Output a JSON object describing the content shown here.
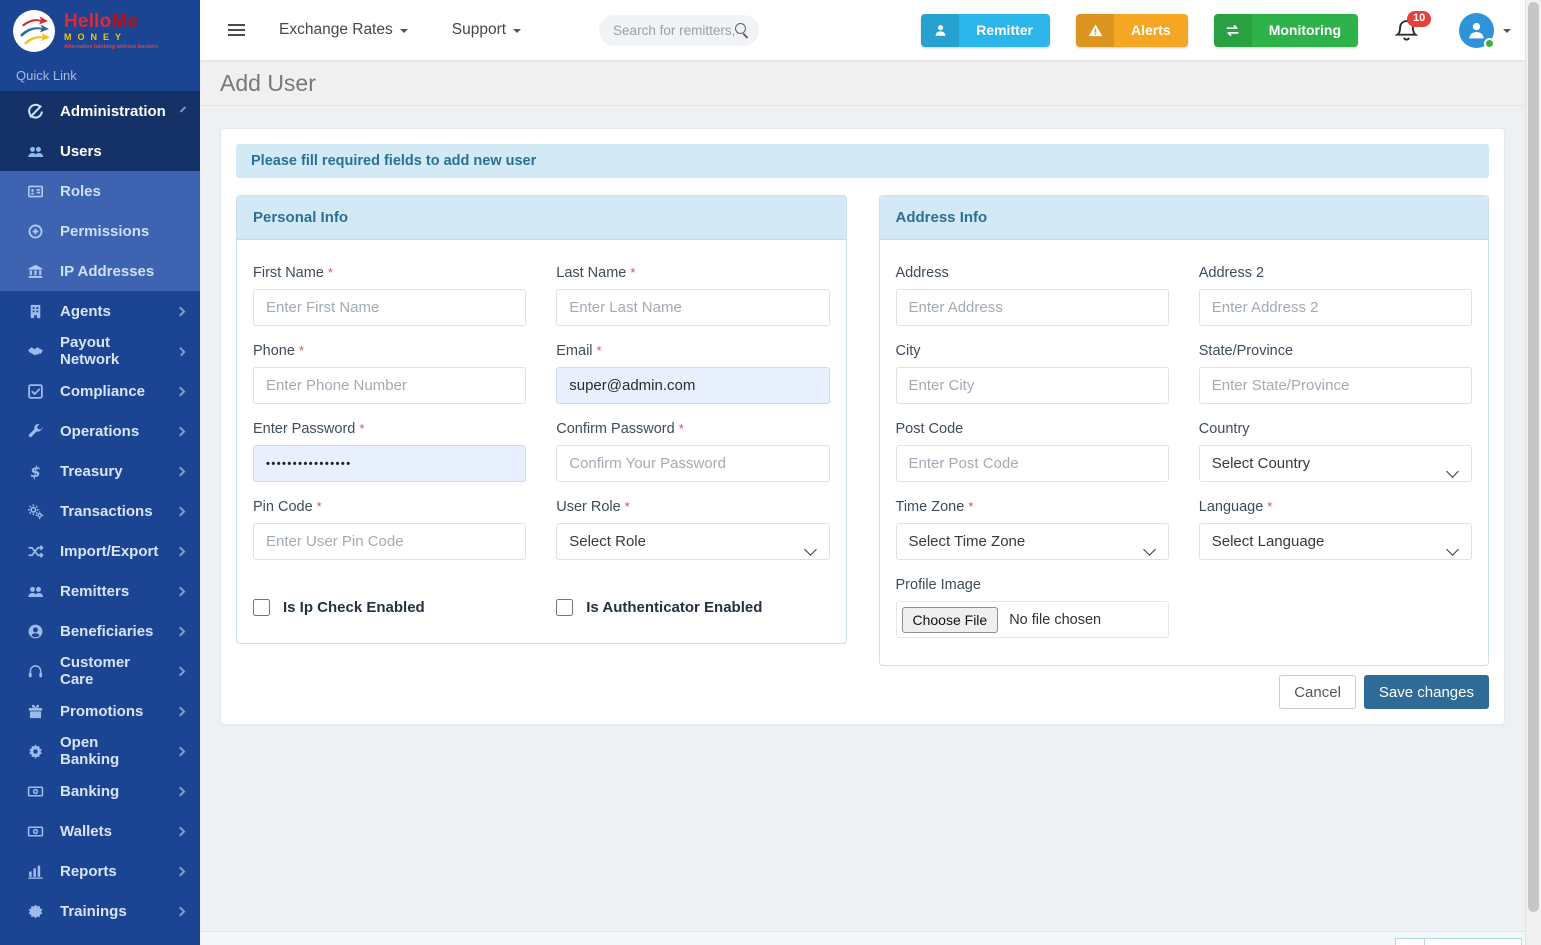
{
  "brand": {
    "hello": "Hello",
    "me": "Me",
    "money": "MONEY",
    "tagline": "Alternative banking without borders",
    "quick_link": "Quick Link"
  },
  "topbar": {
    "menus": [
      {
        "label": "Exchange Rates"
      },
      {
        "label": "Support"
      }
    ],
    "search_placeholder": "Search for remitters, do",
    "actions": [
      {
        "label": "Remitter"
      },
      {
        "label": "Alerts"
      },
      {
        "label": "Monitoring"
      }
    ],
    "notification_count": "10"
  },
  "sidebar": {
    "items": [
      {
        "label": "Administration"
      },
      {
        "label": "Users"
      },
      {
        "label": "Roles"
      },
      {
        "label": "Permissions"
      },
      {
        "label": "IP Addresses"
      },
      {
        "label": "Agents"
      },
      {
        "label": "Payout Network"
      },
      {
        "label": "Compliance"
      },
      {
        "label": "Operations"
      },
      {
        "label": "Treasury"
      },
      {
        "label": "Transactions"
      },
      {
        "label": "Import/Export"
      },
      {
        "label": "Remitters"
      },
      {
        "label": "Beneficiaries"
      },
      {
        "label": "Customer Care"
      },
      {
        "label": "Promotions"
      },
      {
        "label": "Open Banking"
      },
      {
        "label": "Banking"
      },
      {
        "label": "Wallets"
      },
      {
        "label": "Reports"
      },
      {
        "label": "Trainings"
      }
    ]
  },
  "page": {
    "title": "Add User",
    "alert": "Please fill required fields to add new user"
  },
  "personal": {
    "title": "Personal Info",
    "first_name": {
      "label": "First Name",
      "placeholder": "Enter First Name"
    },
    "last_name": {
      "label": "Last Name",
      "placeholder": "Enter Last Name"
    },
    "phone": {
      "label": "Phone",
      "placeholder": "Enter Phone Number"
    },
    "email": {
      "label": "Email",
      "value": "super@admin.com"
    },
    "password": {
      "label": "Enter Password",
      "masked_value": "••••••••••••••••"
    },
    "confirm_password": {
      "label": "Confirm Password",
      "placeholder": "Confirm Your Password"
    },
    "pin_code": {
      "label": "Pin Code",
      "placeholder": "Enter User Pin Code"
    },
    "user_role": {
      "label": "User Role",
      "value": "Select Role"
    },
    "ip_check": {
      "label": "Is Ip Check Enabled"
    },
    "authenticator": {
      "label": "Is Authenticator Enabled"
    }
  },
  "address": {
    "title": "Address Info",
    "address": {
      "label": "Address",
      "placeholder": "Enter Address"
    },
    "address2": {
      "label": "Address 2",
      "placeholder": "Enter Address 2"
    },
    "city": {
      "label": "City",
      "placeholder": "Enter City"
    },
    "state": {
      "label": "State/Province",
      "placeholder": "Enter State/Province"
    },
    "post_code": {
      "label": "Post Code",
      "placeholder": "Enter Post Code"
    },
    "country": {
      "label": "Country",
      "value": "Select Country"
    },
    "time_zone": {
      "label": "Time Zone",
      "value": "Select Time Zone"
    },
    "language": {
      "label": "Language",
      "value": "Select Language"
    },
    "profile_image": {
      "label": "Profile Image",
      "button": "Choose File",
      "status": "No file chosen"
    }
  },
  "footer": {
    "cancel": "Cancel",
    "save": "Save changes"
  },
  "icons": {
    "logo": "three-curved-arrows-circle",
    "hamburger": "menu",
    "search": "magnifier",
    "remitter": "person",
    "alerts": "warning-triangle",
    "monitoring": "exchange-arrows",
    "notifications": "bell",
    "avatar": "person-circle-online-dot",
    "administration": "sync-circle",
    "users": "people",
    "roles": "id-card",
    "permissions": "circle-plus-badge",
    "ip_addresses": "bank-columns",
    "agents": "building",
    "payout_network": "handshake",
    "compliance": "check-square",
    "operations": "wrench",
    "treasury": "dollar-sign",
    "transactions": "gears",
    "import_export": "shuffle-arrows",
    "remitters": "people",
    "beneficiaries": "person-circle",
    "customer_care": "headset",
    "promotions": "gift",
    "open_banking": "gear",
    "banking": "money-bill",
    "wallets": "money-bill",
    "reports": "bar-chart",
    "trainings": "seal"
  },
  "colors": {
    "sidebar": "#1b4492",
    "sidebar_submenu": "#3e63b0",
    "sidebar_active": "#143168",
    "info_bg": "#d3eaf6",
    "info_text": "#2a7096",
    "remitter_btn": "#2cb5e8",
    "alerts_btn": "#f5a623",
    "monitoring_btn": "#2eb34a",
    "save_btn": "#2e6b96",
    "badge": "#e2413c",
    "required": "#d9534f",
    "autofill_bg": "#e8f0fe"
  }
}
